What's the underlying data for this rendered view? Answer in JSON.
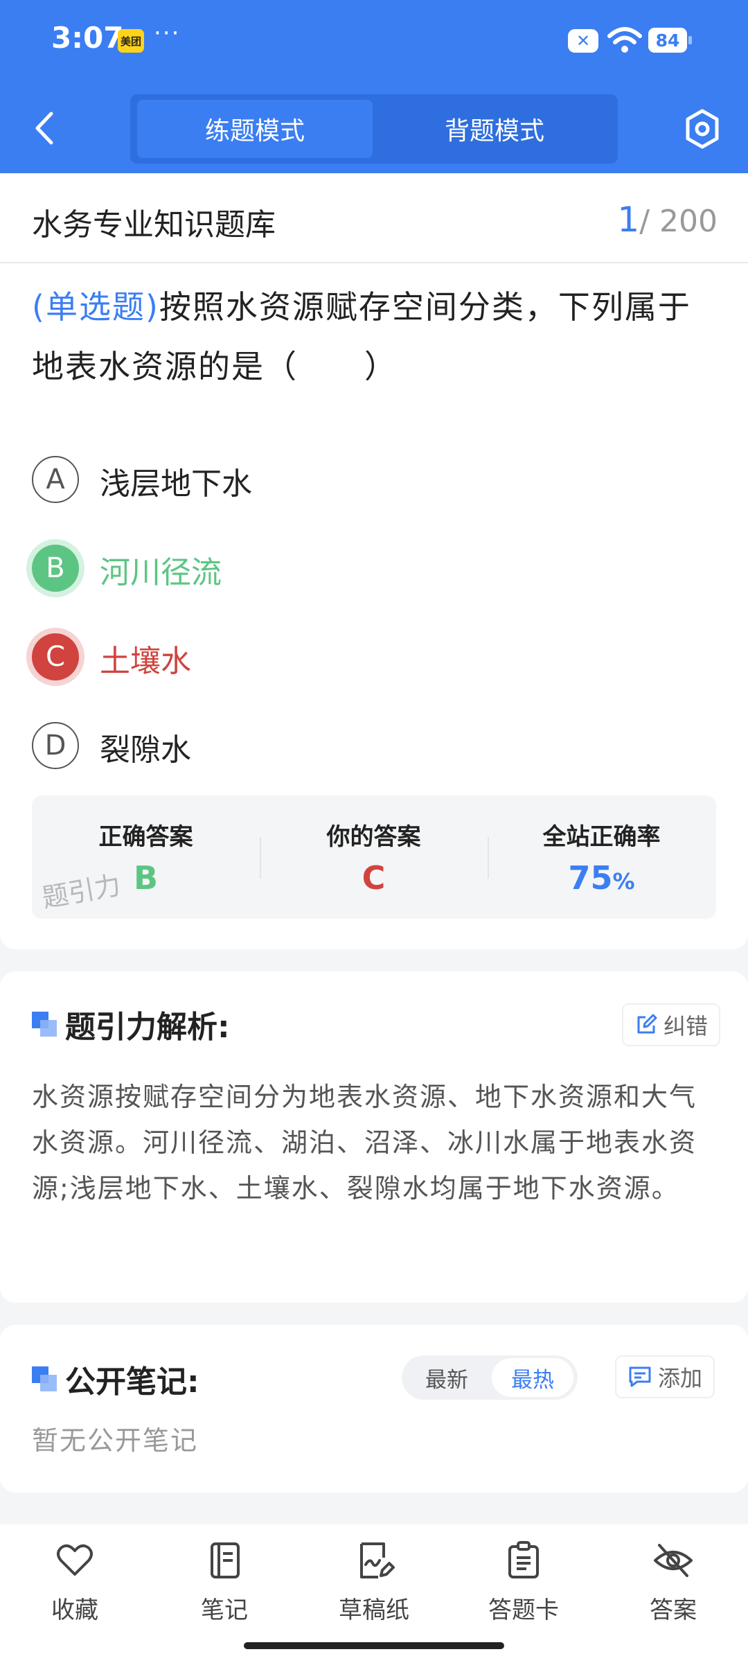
{
  "status_bar": {
    "time": "3:07",
    "app_badge": "美团",
    "dots": "···",
    "battery": "84",
    "x_badge": "✕"
  },
  "header": {
    "tabs": [
      {
        "label": "练题模式",
        "active": true
      },
      {
        "label": "背题模式",
        "active": false
      }
    ],
    "accent_color": "#3b7ef2"
  },
  "bank": {
    "title": "水务专业知识题库",
    "current": "1",
    "separator_total": "/ 200"
  },
  "question": {
    "type_label": "(单选题)",
    "text": "按照水资源赋存空间分类，下列属于地表水资源的是（　　）"
  },
  "options": [
    {
      "letter": "A",
      "text": "浅层地下水",
      "state": "normal"
    },
    {
      "letter": "B",
      "text": "河川径流",
      "state": "correct"
    },
    {
      "letter": "C",
      "text": "土壤水",
      "state": "wrong"
    },
    {
      "letter": "D",
      "text": "裂隙水",
      "state": "normal"
    }
  ],
  "answer_summary": {
    "correct_label": "正确答案",
    "correct_value": "B",
    "yours_label": "你的答案",
    "yours_value": "C",
    "rate_label": "全站正确率",
    "rate_value": "75",
    "rate_unit": "%",
    "watermark": "题引力"
  },
  "analysis": {
    "title": "题引力解析:",
    "correct_button": "纠错",
    "body": "水资源按赋存空间分为地表水资源、地下水资源和大气水资源。河川径流、湖泊、沼泽、冰川水属于地表水资源;浅层地下水、土壤水、裂隙水均属于地下水资源。"
  },
  "notes": {
    "title": "公开笔记:",
    "sort_options": [
      {
        "label": "最新",
        "active": false
      },
      {
        "label": "最热",
        "active": true
      }
    ],
    "add_button": "添加",
    "empty_text": "暂无公开笔记"
  },
  "bottom_nav": [
    {
      "label": "收藏",
      "icon": "heart-icon"
    },
    {
      "label": "笔记",
      "icon": "notebook-icon"
    },
    {
      "label": "草稿纸",
      "icon": "draft-paper-icon"
    },
    {
      "label": "答题卡",
      "icon": "answer-card-icon"
    },
    {
      "label": "答案",
      "icon": "eye-off-icon"
    }
  ],
  "colors": {
    "correct": "#5cc583",
    "wrong": "#d0433e",
    "primary": "#3b7ef2"
  }
}
